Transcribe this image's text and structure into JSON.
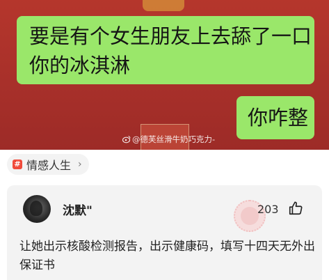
{
  "post_image": {
    "message_received": "要是有个女生朋友上去舔了一口你的冰淇淋",
    "message_sent": "你咋整",
    "watermark": "@德芙丝滑牛奶巧克力-"
  },
  "topic_tag": {
    "label": "情感人生",
    "icon": "hash-icon"
  },
  "comment": {
    "username": "沈默\"",
    "likes": "203",
    "text": "让她出示核酸检测报告，出示健康码，填写十四天无外出保证书"
  },
  "colors": {
    "chat_bubble_green": "#9ae76a",
    "image_background_red": "#a8302a",
    "tag_hash_red": "#f04b3b",
    "card_background": "#f3f3f3"
  }
}
